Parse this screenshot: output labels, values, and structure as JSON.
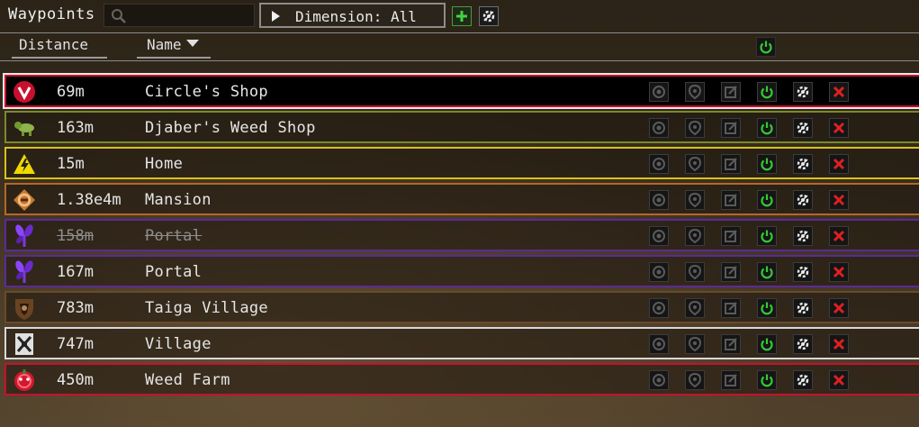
{
  "header": {
    "title": "Waypoints",
    "search": {
      "value": "",
      "placeholder": ""
    },
    "dimension_button": "Dimension: All",
    "add_button": "add",
    "options_button": "options"
  },
  "columns": {
    "distance": "Distance",
    "name": "Name",
    "sort": "descending"
  },
  "colors": {
    "red": "#c8102e",
    "olive": "#7a8a2a",
    "yellow": "#d8c21a",
    "orange": "#b4682a",
    "purple": "#5a2a9a",
    "brown": "#6a4a2a",
    "white": "#d8d8d8",
    "green_power": "#35c935",
    "delete_red": "#e02020"
  },
  "waypoints": [
    {
      "distance": "69m",
      "name": "Circle's Shop",
      "icon": "red-v-circle-icon",
      "border": "#c8102e",
      "enabled": true,
      "selected": true
    },
    {
      "distance": "163m",
      "name": "Djaber's Weed Shop",
      "icon": "green-creature-icon",
      "border": "#7a8a2a",
      "enabled": true,
      "selected": false
    },
    {
      "distance": "15m",
      "name": "Home",
      "icon": "yellow-warning-icon",
      "border": "#d8c21a",
      "enabled": true,
      "selected": false
    },
    {
      "distance": "1.38e4m",
      "name": "Mansion",
      "icon": "orange-emblem-icon",
      "border": "#b4682a",
      "enabled": true,
      "selected": false
    },
    {
      "distance": "158m",
      "name": "Portal",
      "icon": "purple-flower-icon",
      "border": "#5a2a9a",
      "enabled": false,
      "selected": false
    },
    {
      "distance": "167m",
      "name": "Portal",
      "icon": "purple-flower-icon",
      "border": "#5a2a9a",
      "enabled": true,
      "selected": false
    },
    {
      "distance": "783m",
      "name": "Taiga Village",
      "icon": "brown-shield-icon",
      "border": "#6a4a2a",
      "enabled": true,
      "selected": false
    },
    {
      "distance": "747m",
      "name": "Village",
      "icon": "white-banner-icon",
      "border": "#d8d8d8",
      "enabled": true,
      "selected": false
    },
    {
      "distance": "450m",
      "name": "Weed Farm",
      "icon": "red-pumpkin-icon",
      "border": "#c8102e",
      "enabled": true,
      "selected": false
    }
  ],
  "row_actions": [
    "teleport-icon",
    "waypoint-pin-icon",
    "edit-icon",
    "toggle-power-icon",
    "options-icon",
    "delete-icon"
  ]
}
